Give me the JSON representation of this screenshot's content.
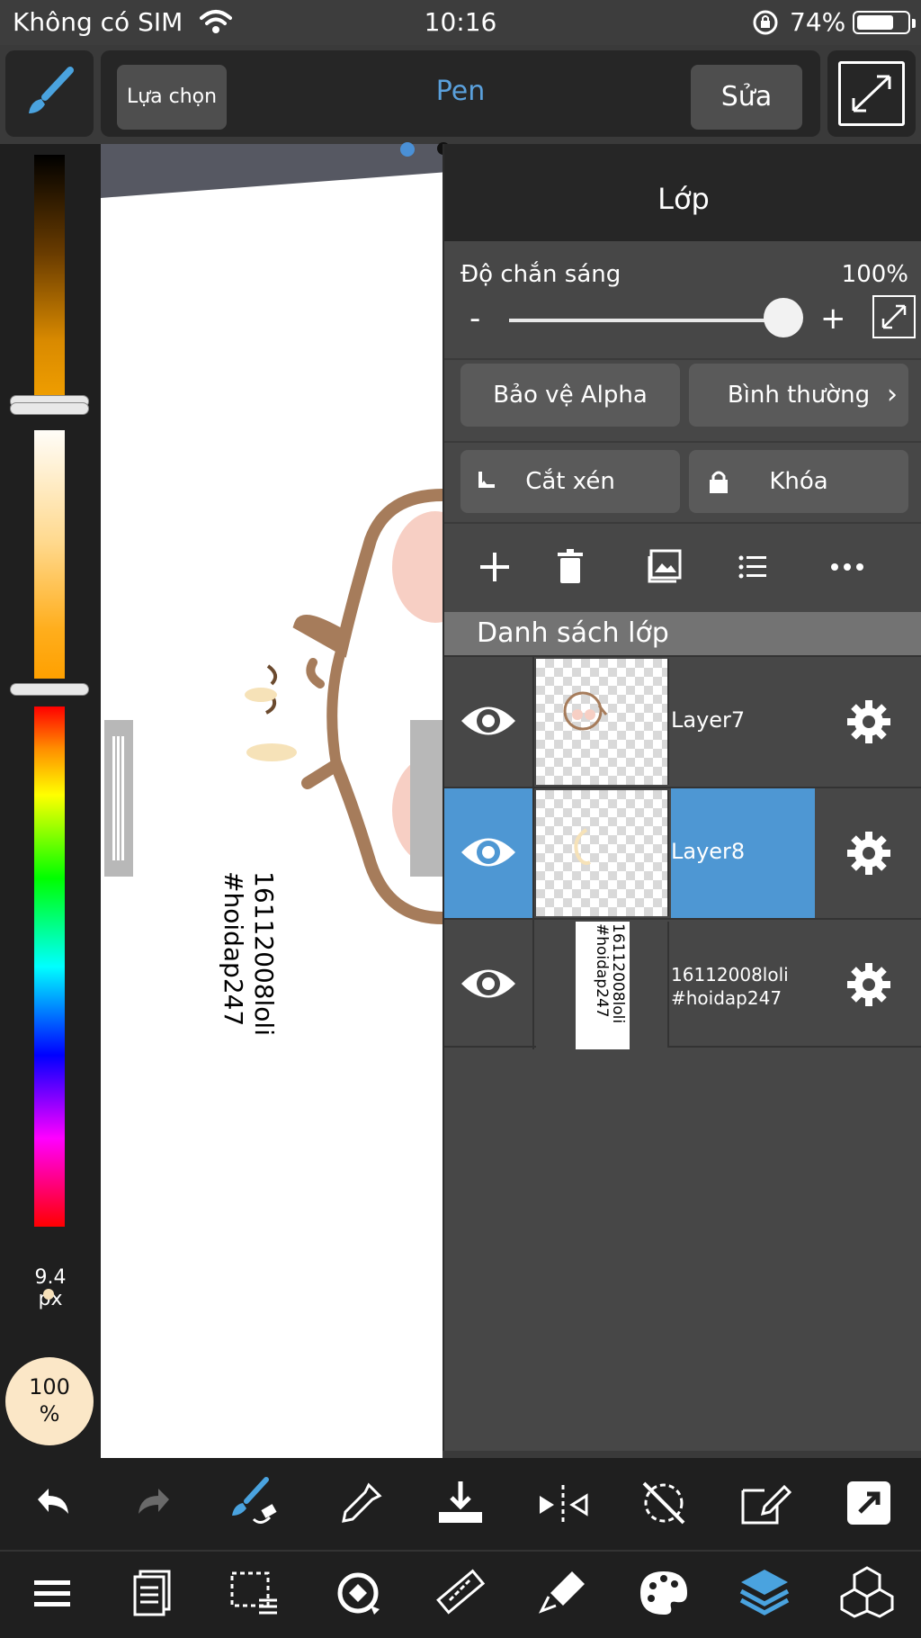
{
  "status_bar": {
    "carrier": "Không có SIM",
    "time": "10:16",
    "battery_percent": "74%",
    "battery_level": 0.74
  },
  "toolbar": {
    "select_label": "Lựa chọn",
    "tool_name": "Pen",
    "edit_label": "Sửa",
    "accent_color": "#5aa0dc"
  },
  "left_panel": {
    "brush_size": "9.4",
    "brush_unit": "px",
    "opacity_value": "100",
    "opacity_unit": "%"
  },
  "canvas": {
    "text_line_1": "16112008loli",
    "text_line_2": "#hoidap247"
  },
  "layer_panel": {
    "title": "Lớp",
    "opacity_label": "Độ chắn sáng",
    "opacity_value": "100%",
    "minus": "-",
    "plus": "+",
    "alpha_protect": "Bảo vệ Alpha",
    "blend_mode": "Bình thường",
    "clipping": "Cắt xén",
    "lock": "Khóa",
    "list_header": "Danh sách lớp",
    "layers": [
      {
        "name": "Layer7",
        "selected": false,
        "visible": true
      },
      {
        "name": "Layer8",
        "selected": true,
        "visible": true
      },
      {
        "name": "16112008loli #hoidap247",
        "line_1": "16112008loli",
        "line_2": "#hoidap247",
        "selected": false,
        "visible": true
      }
    ],
    "selected_color": "#4e97d3"
  }
}
